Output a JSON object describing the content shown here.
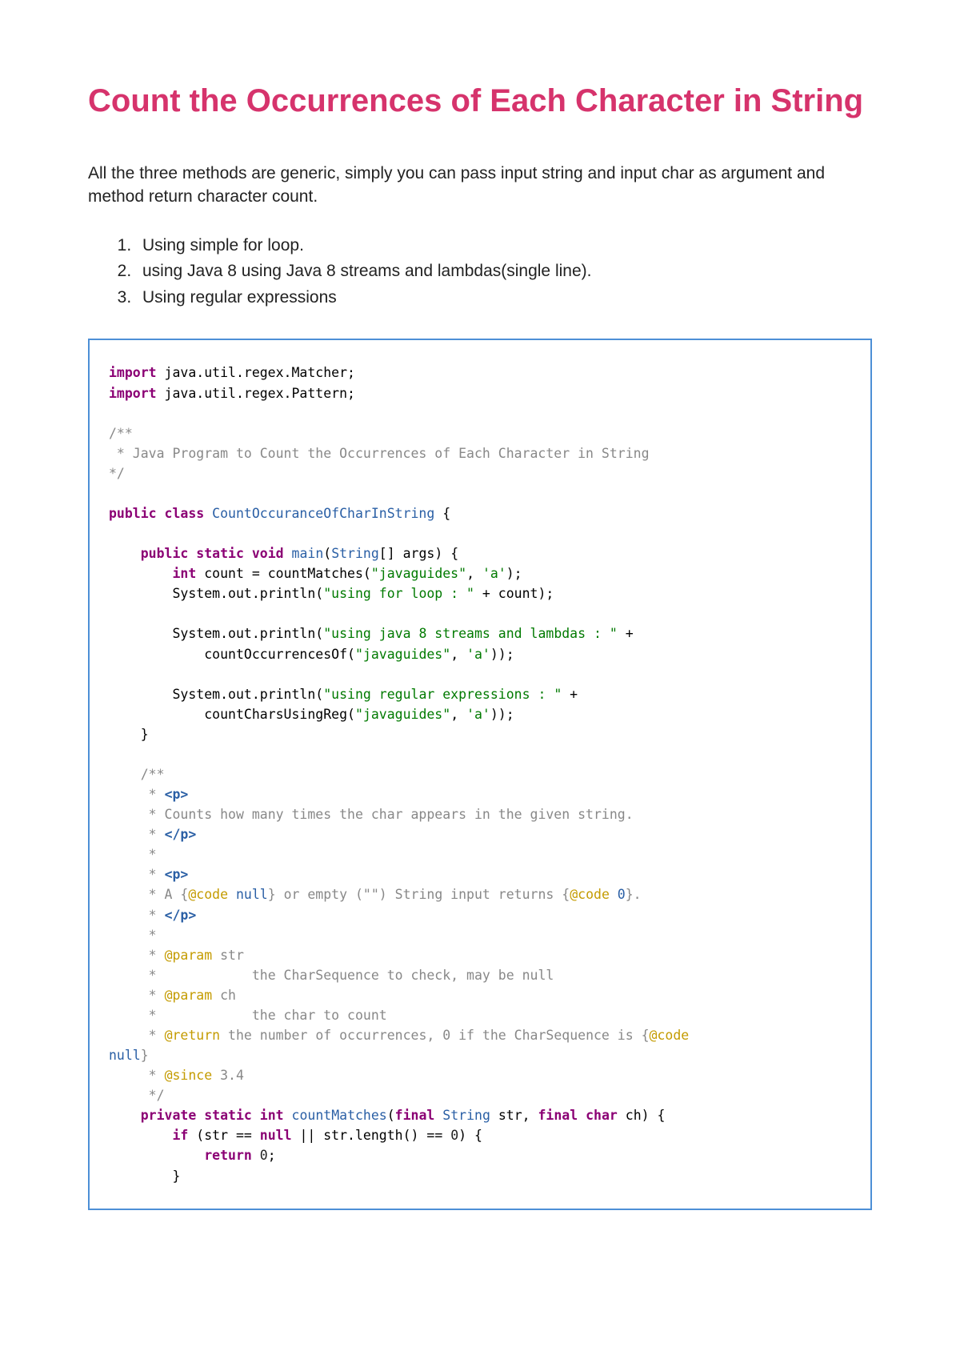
{
  "heading": "Count the Occurrences of Each Character in String",
  "intro": "All the three methods are generic, simply you can pass input string and input char as argument and method return character count.",
  "list": {
    "item1": "Using simple for loop.",
    "item2": "using Java 8 using Java 8 streams and lambdas(single line).",
    "item3": "Using regular expressions"
  },
  "code": {
    "kw_import1": "import",
    "import1_text": " java.util.regex.Matcher;",
    "kw_import2": "import",
    "import2_text": " java.util.regex.Pattern;",
    "c1": "/**",
    "c2": " * Java Program to Count the Occurrences of Each Character in String",
    "c3": "*/",
    "kw_public1": "public",
    "kw_class": " class",
    "classname": " CountOccuranceOfCharInString",
    "brace_open1": " {",
    "indent1": "    ",
    "kw_public2": "public",
    "kw_static1": " static",
    "kw_void": " void",
    "main_name": " main",
    "main_args_open": "(",
    "string_type": "String",
    "args_text": "[] args) {",
    "indent2": "        ",
    "kw_int": "int",
    "count_assign": " count = countMatches(",
    "str_javaguides1": "\"javaguides\"",
    "comma_a1": ", ",
    "str_a1": "'a'",
    "close_paren1": ");",
    "sysout1": "System.out.println(",
    "str_forloop": "\"using for loop : \"",
    "plus_count": " + count);",
    "sysout2": "System.out.println(",
    "str_java8": "\"using java 8 streams and lambdas : \"",
    "plus": " +",
    "indent3": "            ",
    "countOccur": "countOccurrencesOf(",
    "str_javaguides2": "\"javaguides\"",
    "comma_a2": ", ",
    "str_a2": "'a'",
    "close2": "));",
    "sysout3": "System.out.println(",
    "str_regex": "\"using regular expressions : \"",
    "countReg": "countCharsUsingReg(",
    "str_javaguides3": "\"javaguides\"",
    "str_a3": "'a'",
    "close3": "));",
    "brace_close1": "}",
    "c4": "/**",
    "c5_star": " * ",
    "c5_tag": "<p>",
    "c6": " * Counts how many times the char appears in the given string.",
    "c7_star": " * ",
    "c7_tag": "</p>",
    "c8": " *",
    "c9_star": " * ",
    "c9_tag": "<p>",
    "c10_a": " * A {",
    "c10_code": "@code",
    "c10_null": " null",
    "c10_b": "} or empty (\"\") String input returns {",
    "c10_code2": "@code",
    "c10_zero": " 0",
    "c10_c": "}.",
    "c11_star": " * ",
    "c11_tag": "</p>",
    "c12": " *",
    "c13_star": " * ",
    "c13_param": "@param",
    "c13_str": " str",
    "c14": " *            the CharSequence to check, may be null",
    "c15_star": " * ",
    "c15_param": "@param",
    "c15_ch": " ch",
    "c16": " *            the char to count",
    "c17_star": " * ",
    "c17_ret": "@return",
    "c17_text": " the number of occurrences, 0 if the CharSequence is {",
    "c17_code": "@code",
    "c17_null": "null",
    "c17_close": "}",
    "c18_star": " * ",
    "c18_since": "@since",
    "c18_ver": " 3.4",
    "c19": " */",
    "kw_private": "private",
    "kw_static2": " static",
    "kw_int2": " int",
    "method_name": " countMatches",
    "open_paren2": "(",
    "kw_final1": "final",
    "str_type": " String",
    "param_str": " str, ",
    "kw_final2": "final",
    "kw_char": " char",
    "param_ch": " ch) {",
    "kw_if": "if",
    "if_cond_a": " (str == ",
    "kw_null1": "null",
    "if_cond_b": " || str.length() == ",
    "zero1": "0",
    "if_cond_c": ") {",
    "kw_return": "return",
    "ret_zero": " 0",
    "semi": ";",
    "brace_close2": "}"
  }
}
